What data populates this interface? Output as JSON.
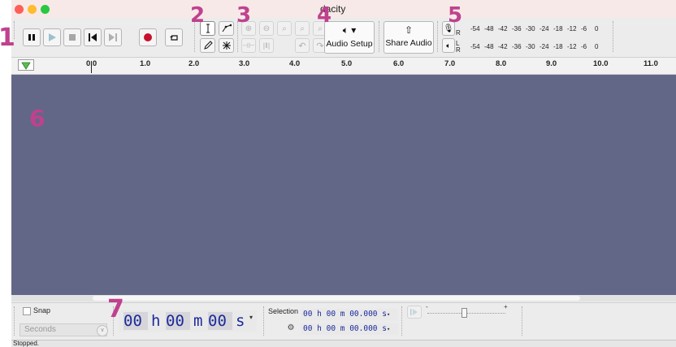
{
  "window": {
    "title": "dacity"
  },
  "annotations": [
    "1",
    "2",
    "3",
    "4",
    "5",
    "6",
    "7"
  ],
  "toolbar": {
    "audio_setup_label": "Audio Setup",
    "share_audio_label": "Share Audio"
  },
  "meters": {
    "record": {
      "channels": [
        "R"
      ],
      "ticks": [
        "-54",
        "-48",
        "-42",
        "-36",
        "-30",
        "-24",
        "-18",
        "-12",
        "-6",
        "0"
      ]
    },
    "playback": {
      "channels": [
        "L",
        "R"
      ],
      "ticks": [
        "-54",
        "-48",
        "-42",
        "-36",
        "-30",
        "-24",
        "-18",
        "-12",
        "-6",
        "0"
      ]
    }
  },
  "ruler": {
    "labels": [
      "0.0",
      "1.0",
      "2.0",
      "3.0",
      "4.0",
      "5.0",
      "6.0",
      "7.0",
      "8.0",
      "9.0",
      "10.0",
      "11.0"
    ]
  },
  "bottom": {
    "snap_label": "Snap",
    "snap_unit": "Seconds",
    "time": {
      "h": "00",
      "h_unit": "h",
      "m": "00",
      "m_unit": "m",
      "s": "00",
      "s_unit": "s"
    },
    "selection_label": "Selection",
    "selection_start": "00 h 00 m 00.000 s",
    "selection_end": "00 h 00 m 00.000 s",
    "speed_min": "-",
    "speed_max": "+"
  },
  "status": {
    "text": "Stopped."
  },
  "colors": {
    "track_bg": "#636787",
    "annotation": "#c0418e",
    "record_red": "#c8102e",
    "play_green": "#4cb050",
    "time_digits": "#1c2a9a"
  }
}
